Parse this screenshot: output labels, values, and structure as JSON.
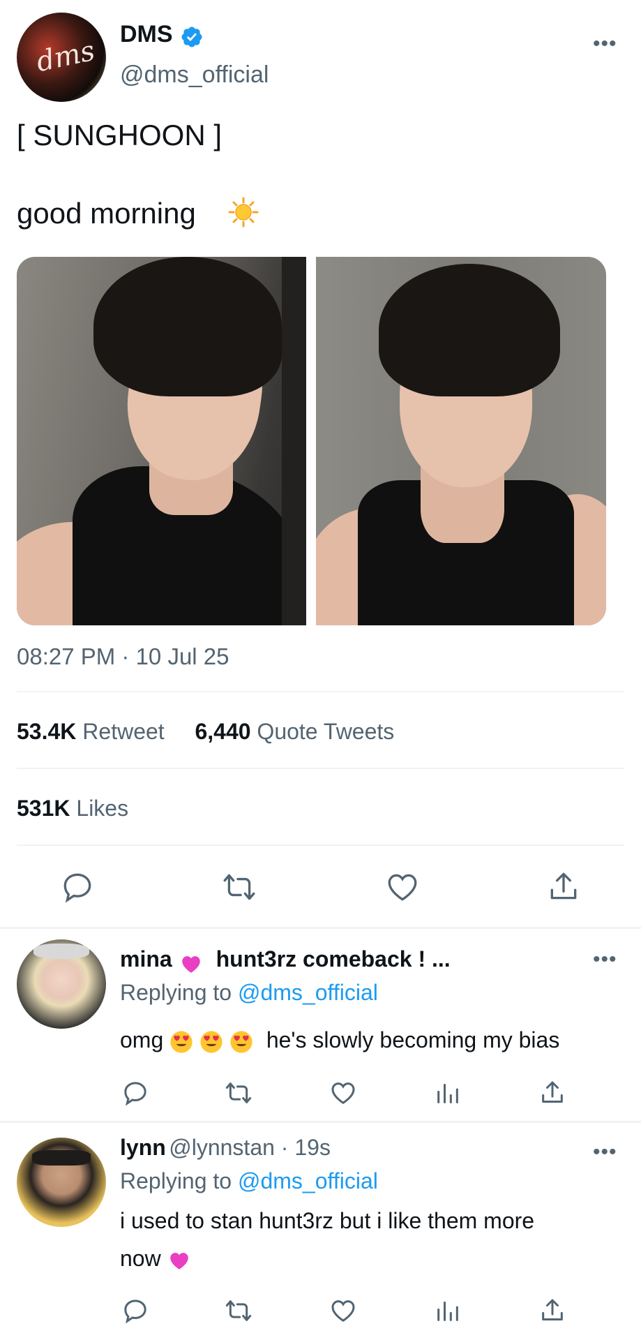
{
  "tweet": {
    "author_name": "DMS",
    "author_handle": "@dms_official",
    "avatar_text": "dms",
    "text_line1": "[ SUNGHOON ]",
    "text_line2": "good morning",
    "timestamp": "08:27 PM · 10 Jul 25",
    "retweets_count": "53.4K",
    "retweets_label": "Retweet",
    "quotes_count": "6,440",
    "quotes_label": "Quote Tweets",
    "likes_count": "531K",
    "likes_label": "Likes",
    "more": "•••"
  },
  "replies": [
    {
      "name": "mina",
      "display_suffix": "hunt3rz comeback ! ...",
      "replying_label": "Replying to",
      "replying_to": "@dms_official",
      "text_before": "omg",
      "text_after": "he's slowly becoming my bias",
      "more": "•••"
    },
    {
      "name": "lynn",
      "handle_time": "@lynnstan · 19s",
      "replying_label": "Replying to",
      "replying_to": "@dms_official",
      "text_line1": "i used to stan hunt3rz but i like them more",
      "text_line2": "now",
      "more": "•••"
    }
  ],
  "icons": [
    "verified-badge-icon",
    "sun-emoji-icon",
    "reply-icon",
    "retweet-icon",
    "like-icon",
    "share-icon",
    "views-icon",
    "heart-eyes-emoji-icon",
    "pink-heart-emoji-icon"
  ],
  "colors": {
    "accent": "#1d9bf0",
    "secondary_text": "#536471",
    "divider": "#eff3f4",
    "icon": "#536471"
  }
}
